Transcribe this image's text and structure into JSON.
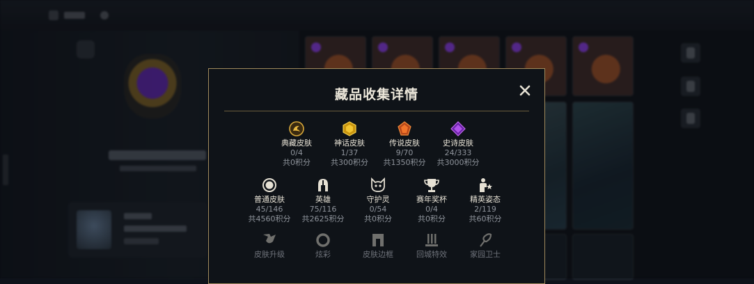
{
  "modal": {
    "title": "藏品收集详情",
    "close_icon": "close-icon"
  },
  "rows": [
    [
      {
        "name": "典藏皮肤",
        "count": "0/4",
        "points": "共0积分",
        "icon": "dragon-gem-icon",
        "color": "#d8a83a"
      },
      {
        "name": "神话皮肤",
        "count": "1/37",
        "points": "共300积分",
        "icon": "yellow-gem-icon",
        "color": "#e3b21e"
      },
      {
        "name": "传说皮肤",
        "count": "9/70",
        "points": "共1350积分",
        "icon": "orange-gem-icon",
        "color": "#e0702a"
      },
      {
        "name": "史诗皮肤",
        "count": "24/333",
        "points": "共3000积分",
        "icon": "purple-gem-icon",
        "color": "#a348e0"
      }
    ],
    [
      {
        "name": "普通皮肤",
        "count": "45/146",
        "points": "共4560积分",
        "icon": "circle-skin-icon",
        "color": "#e6e1d4"
      },
      {
        "name": "英雄",
        "count": "75/116",
        "points": "共2625积分",
        "icon": "helmet-icon",
        "color": "#e6e1d4"
      },
      {
        "name": "守护灵",
        "count": "0/54",
        "points": "共0积分",
        "icon": "cat-face-icon",
        "color": "#e6e1d4"
      },
      {
        "name": "赛年奖杯",
        "count": "0/4",
        "points": "共0积分",
        "icon": "trophy-icon",
        "color": "#e6e1d4"
      },
      {
        "name": "精英姿态",
        "count": "2/119",
        "points": "共60积分",
        "icon": "pose-icon",
        "color": "#e6e1d4"
      }
    ],
    [
      {
        "name": "皮肤升级",
        "icon": "mask-icon",
        "color": "#8a8e96"
      },
      {
        "name": "炫彩",
        "icon": "ring-icon",
        "color": "#8a8e96"
      },
      {
        "name": "皮肤边框",
        "icon": "frame-icon",
        "color": "#8a8e96"
      },
      {
        "name": "回城特效",
        "icon": "recall-icon",
        "color": "#8a8e96"
      },
      {
        "name": "家园卫士",
        "icon": "feather-icon",
        "color": "#8a8e96"
      }
    ]
  ]
}
